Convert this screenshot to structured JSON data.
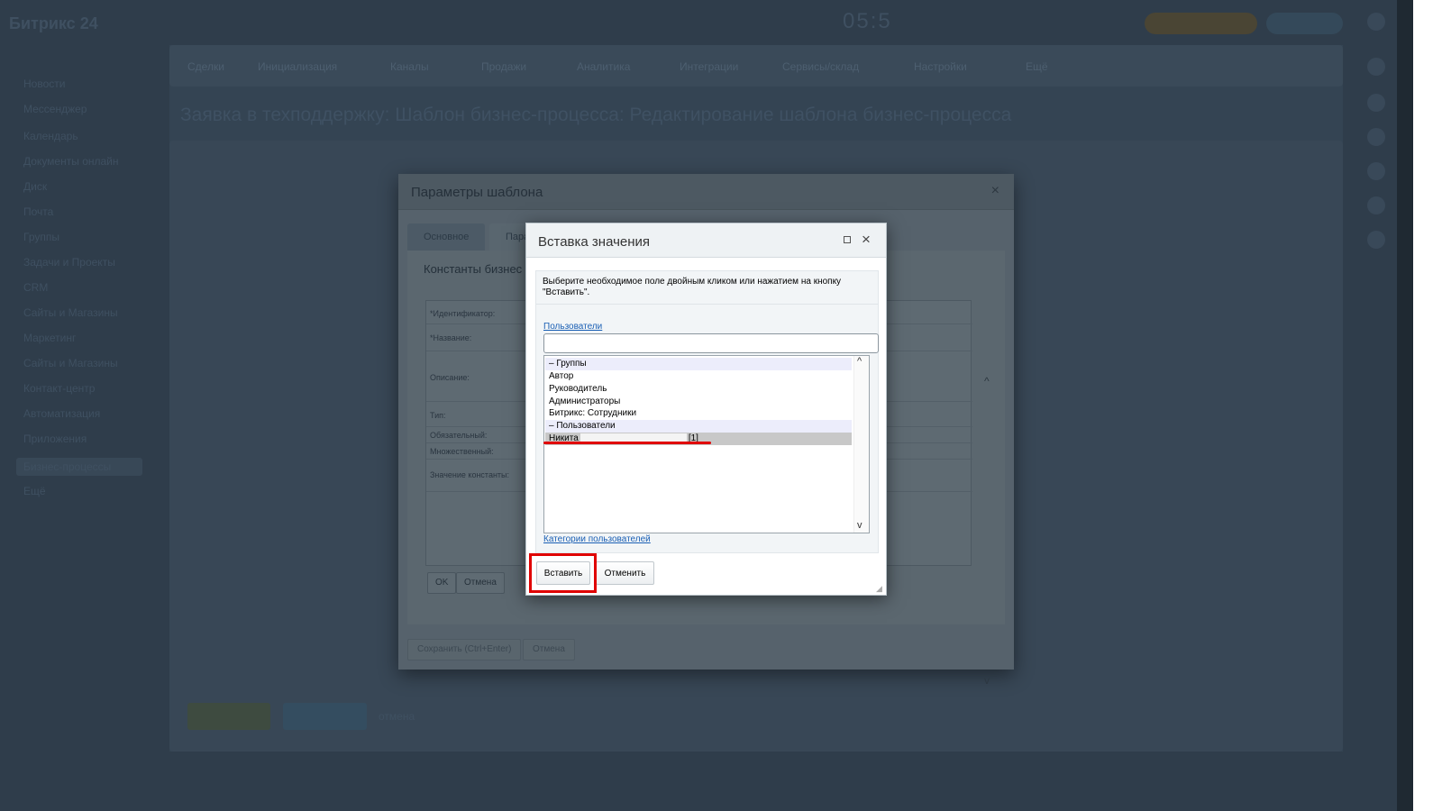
{
  "background": {
    "logo": "Битрикс",
    "logo_suffix": "24",
    "clock": "05:5",
    "nav_tabs": [
      "Сделки",
      "Инициализация",
      "Каналы",
      "Продажи",
      "Аналитика",
      "Интеграции",
      "Сервисы/склад",
      "Настройки",
      "Ещё"
    ],
    "page_title": "Заявка в техподдержку: Шаблон бизнес-процесса: Редактирование шаблона бизнес-процесса",
    "menu_items": [
      "Новости",
      "Мессенджер",
      "Календарь",
      "Документы онлайн",
      "Диск",
      "Почта",
      "Группы",
      "Задачи и Проекты",
      "CRM",
      "Сайты и Магазины",
      "Маркетинг",
      "Сайты и Магазины",
      "Контакт-центр",
      "Автоматизация",
      "Приложения",
      "Бизнес-процессы",
      "Ещё"
    ],
    "footer_cancel": "отмена"
  },
  "dialog_params": {
    "title": "Параметры шаблона",
    "close_glyph": "×",
    "tabs": [
      "Основное",
      "Пара"
    ],
    "section_title": "Константы бизнес",
    "rows": [
      "*Идентификатор:",
      "*Название:",
      "Описание:",
      "Тип:",
      "Обязательный:",
      "Множественный:",
      "Значение константы:"
    ],
    "ok_label": "OK",
    "cancel_label": "Отмена",
    "save_label": "Сохранить (Ctrl+Enter)",
    "foot_cancel_label": "Отмена"
  },
  "dialog_insert": {
    "title": "Вставка значения",
    "maximize_icon": "maximize-icon",
    "close_glyph": "×",
    "hint": "Выберите необходимое поле двойным кликом или нажатием на кнопку \"Вставить\".",
    "users_link": "Пользователи",
    "search_value": "",
    "list": [
      {
        "label": "– Группы",
        "kind": "group"
      },
      {
        "label": "Автор",
        "kind": "item"
      },
      {
        "label": "Руководитель",
        "kind": "item"
      },
      {
        "label": "Администраторы",
        "kind": "item"
      },
      {
        "label": "Битрикс: Сотрудники",
        "kind": "item"
      },
      {
        "label": "– Пользователи",
        "kind": "group"
      },
      {
        "label": "Никита",
        "suffix": "[1]",
        "kind": "selected"
      }
    ],
    "categories_link": "Категории пользователей",
    "insert_label": "Вставить",
    "cancel_label": "Отменить"
  },
  "colors": {
    "highlight_red": "#e00000",
    "link_blue": "#1a5fb4"
  }
}
